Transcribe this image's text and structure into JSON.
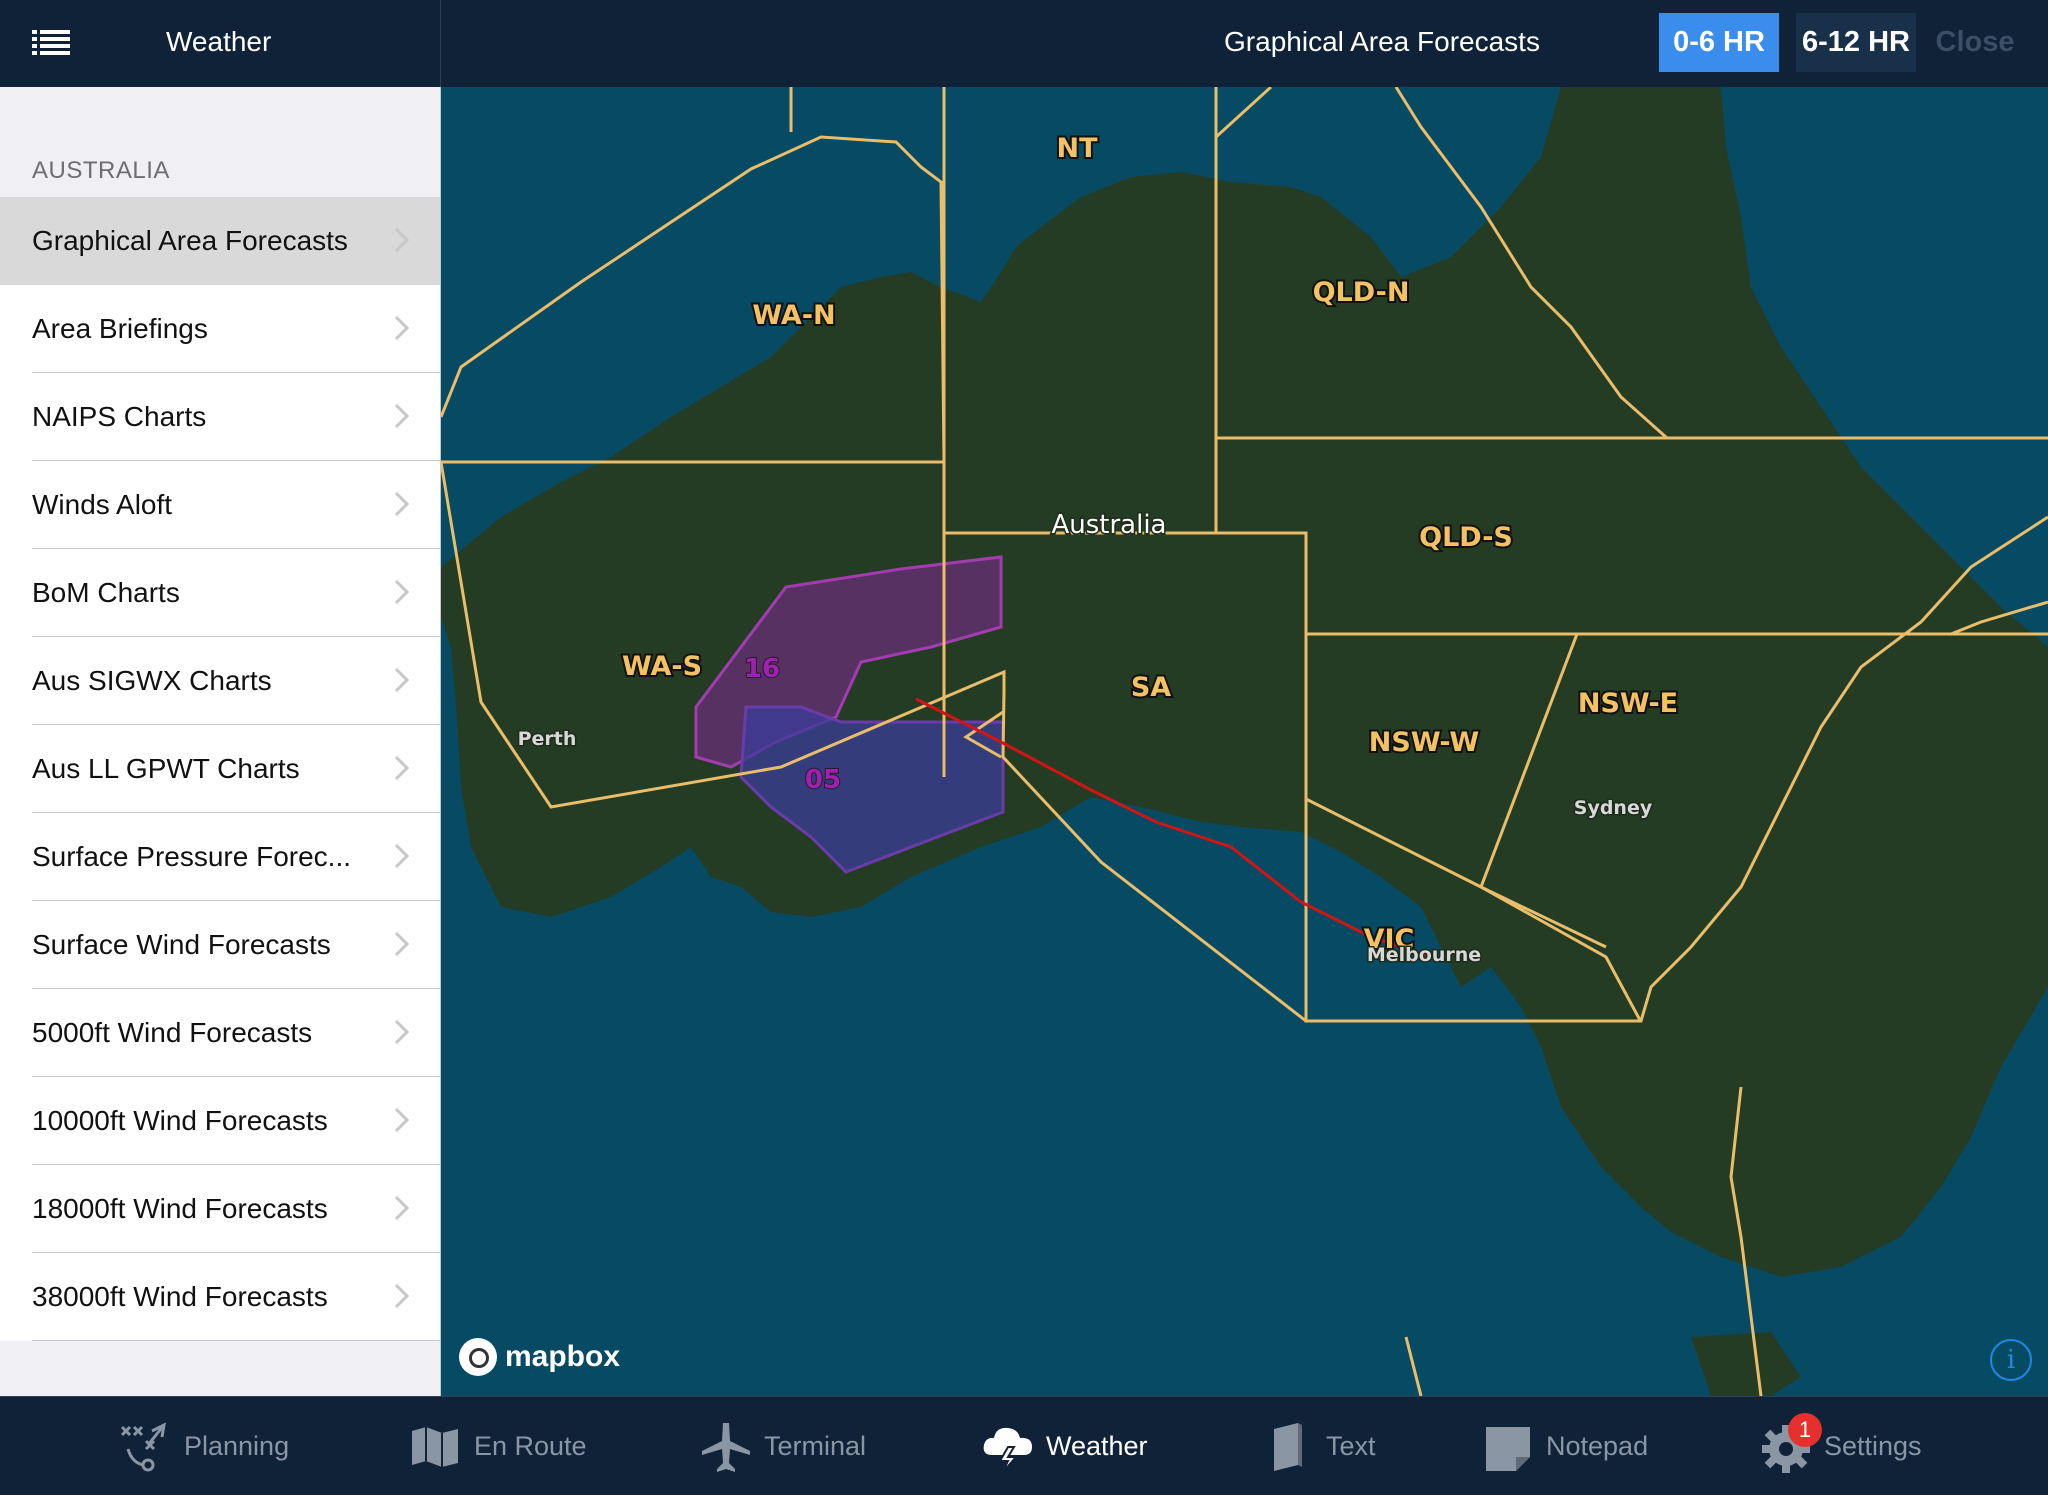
{
  "header": {
    "left_title": "Weather",
    "center_title": "Graphical Area Forecasts",
    "segments": [
      {
        "label": "0-6 HR",
        "selected": true
      },
      {
        "label": "6-12 HR",
        "selected": false
      }
    ],
    "close_label": "Close"
  },
  "sidebar": {
    "section": "AUSTRALIA",
    "items": [
      {
        "label": "Graphical Area Forecasts",
        "selected": true
      },
      {
        "label": "Area Briefings"
      },
      {
        "label": "NAIPS Charts"
      },
      {
        "label": "Winds Aloft"
      },
      {
        "label": "BoM Charts"
      },
      {
        "label": "Aus SIGWX Charts"
      },
      {
        "label": "Aus LL GPWT Charts"
      },
      {
        "label": "Surface Pressure Forec..."
      },
      {
        "label": "Surface Wind Forecasts"
      },
      {
        "label": "5000ft Wind Forecasts"
      },
      {
        "label": "10000ft Wind Forecasts"
      },
      {
        "label": "18000ft Wind Forecasts"
      },
      {
        "label": "38000ft Wind Forecasts"
      }
    ]
  },
  "map": {
    "country_label": "Australia",
    "areas": [
      "NT",
      "WA-N",
      "QLD-N",
      "QLD-S",
      "SA",
      "WA-S",
      "NSW-E",
      "NSW-W",
      "VIC"
    ],
    "cities": [
      "Perth",
      "Sydney",
      "Melbourne"
    ],
    "wx_areas": [
      "16",
      "05"
    ],
    "attribution": "mapbox",
    "info_glyph": "i",
    "colors": {
      "water": "#074a63",
      "land": "#253c24",
      "boundary": "#e9bd6a",
      "route": "#d11414",
      "wx_purple": "#7a2a8a",
      "wx_blue": "#3a3c9a"
    }
  },
  "tabbar": {
    "tabs": [
      {
        "label": "Planning",
        "icon": "planning-icon",
        "active": false
      },
      {
        "label": "En Route",
        "icon": "map-icon",
        "active": false
      },
      {
        "label": "Terminal",
        "icon": "airplane-icon",
        "active": false
      },
      {
        "label": "Weather",
        "icon": "cloud-lightning-icon",
        "active": true
      },
      {
        "label": "Text",
        "icon": "book-icon",
        "active": false
      },
      {
        "label": "Notepad",
        "icon": "notepad-icon",
        "active": false
      },
      {
        "label": "Settings",
        "icon": "gear-icon",
        "active": false,
        "badge": "1"
      }
    ]
  }
}
